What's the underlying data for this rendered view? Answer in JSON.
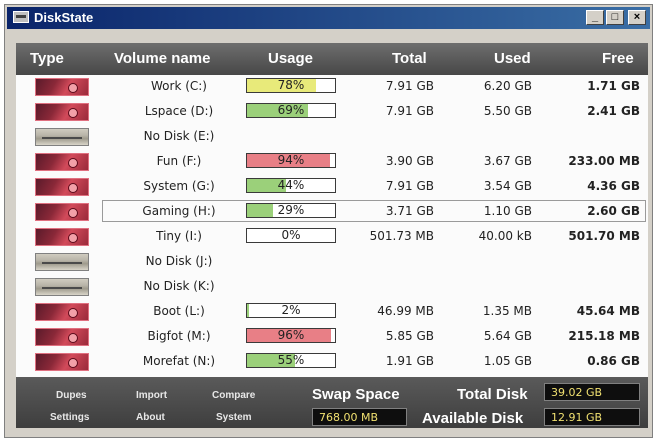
{
  "window": {
    "title": "DiskState",
    "buttons": {
      "minimize": "_",
      "maximize": "□",
      "close": "×"
    }
  },
  "header": {
    "type": "Type",
    "volume": "Volume name",
    "usage": "Usage",
    "total": "Total",
    "used": "Used",
    "free": "Free"
  },
  "colors": {
    "usage_low": "#9bd07a",
    "usage_mid": "#e8ea7a",
    "usage_high": "#e87f86",
    "free_box_text": "#f0e070"
  },
  "volumes": [
    {
      "name": "Work (C:)",
      "drive_image": "photo",
      "usage_percent": 78,
      "usage_label": "78%",
      "usage_color": "#e8ea7a",
      "total": "7.91 GB",
      "used": "6.20 GB",
      "free": "1.71 GB"
    },
    {
      "name": "Lspace (D:)",
      "drive_image": "photo",
      "usage_percent": 69,
      "usage_label": "69%",
      "usage_color": "#9bd07a",
      "total": "7.91 GB",
      "used": "5.50 GB",
      "free": "2.41 GB"
    },
    {
      "name": "No Disk (E:)",
      "drive_image": "empty-drive",
      "usage_percent": null,
      "usage_label": "",
      "usage_color": "",
      "total": "",
      "used": "",
      "free": ""
    },
    {
      "name": "Fun (F:)",
      "drive_image": "photo",
      "usage_percent": 94,
      "usage_label": "94%",
      "usage_color": "#e87f86",
      "total": "3.90 GB",
      "used": "3.67 GB",
      "free": "233.00 MB"
    },
    {
      "name": "System (G:)",
      "drive_image": "photo",
      "usage_percent": 44,
      "usage_label": "44%",
      "usage_color": "#9bd07a",
      "total": "7.91 GB",
      "used": "3.54 GB",
      "free": "4.36 GB"
    },
    {
      "name": "Gaming (H:)",
      "drive_image": "photo",
      "usage_percent": 29,
      "usage_label": "29%",
      "usage_color": "#9bd07a",
      "total": "3.71 GB",
      "used": "1.10 GB",
      "free": "2.60 GB",
      "selected": true
    },
    {
      "name": "Tiny (I:)",
      "drive_image": "photo",
      "usage_percent": 0,
      "usage_label": "0%",
      "usage_color": "#9bd07a",
      "total": "501.73 MB",
      "used": "40.00 kB",
      "free": "501.70 MB"
    },
    {
      "name": "No Disk (J:)",
      "drive_image": "empty-drive",
      "usage_percent": null,
      "usage_label": "",
      "usage_color": "",
      "total": "",
      "used": "",
      "free": ""
    },
    {
      "name": "No Disk (K:)",
      "drive_image": "empty-drive",
      "usage_percent": null,
      "usage_label": "",
      "usage_color": "",
      "total": "",
      "used": "",
      "free": ""
    },
    {
      "name": "Boot (L:)",
      "drive_image": "photo",
      "usage_percent": 2,
      "usage_label": "2%",
      "usage_color": "#9bd07a",
      "total": "46.99 MB",
      "used": "1.35 MB",
      "free": "45.64 MB"
    },
    {
      "name": "Bigfot (M:)",
      "drive_image": "photo",
      "usage_percent": 96,
      "usage_label": "96%",
      "usage_color": "#e87f86",
      "total": "5.85 GB",
      "used": "5.64 GB",
      "free": "215.18 MB"
    },
    {
      "name": "Morefat (N:)",
      "drive_image": "photo",
      "usage_percent": 55,
      "usage_label": "55%",
      "usage_color": "#9bd07a",
      "total": "1.91 GB",
      "used": "1.05 GB",
      "free": "0.86 GB"
    }
  ],
  "footer": {
    "buttons": {
      "dupes": "Dupes",
      "import": "Import",
      "compare": "Compare",
      "settings": "Settings",
      "about": "About",
      "system": "System"
    },
    "swap_label": "Swap Space",
    "swap_value": "768.00 MB",
    "total_disk_label": "Total Disk",
    "total_disk_value": "39.02 GB",
    "available_disk_label": "Available Disk",
    "available_disk_value": "12.91 GB"
  }
}
